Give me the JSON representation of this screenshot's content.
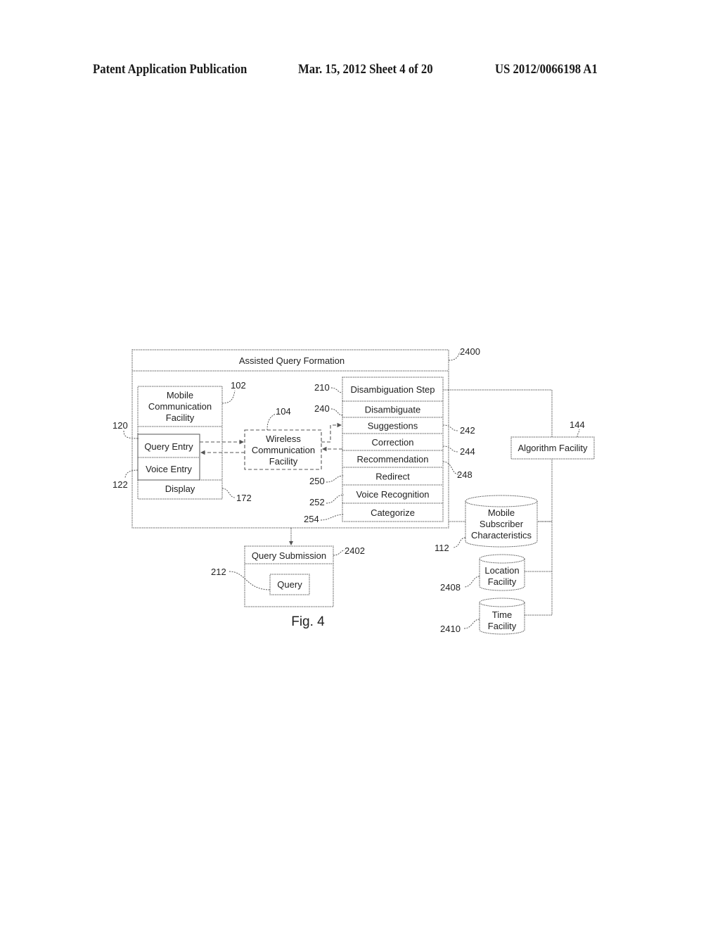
{
  "header": {
    "publication": "Patent Application Publication",
    "date_sheet": "Mar. 15, 2012  Sheet 4 of 20",
    "patent_number": "US 2012/0066198 A1"
  },
  "diagram": {
    "figure_label": "Fig. 4",
    "assisted_query_formation": {
      "title": "Assisted Query Formation",
      "ref": "2400"
    },
    "mobile_communication_facility": {
      "title_lines": [
        "Mobile",
        "Communication",
        "Facility"
      ],
      "ref": "102",
      "query_entry": {
        "label": "Query Entry",
        "ref": "120"
      },
      "voice_entry": {
        "label": "Voice Entry",
        "ref": "122"
      },
      "display": {
        "label": "Display",
        "ref": "172"
      }
    },
    "wireless_communication_facility": {
      "lines": [
        "Wireless",
        "Communication",
        "Facility"
      ],
      "ref": "104"
    },
    "disambiguation_steps": [
      {
        "label": "Disambiguation Step",
        "ref": "210"
      },
      {
        "label": "Disambiguate",
        "ref": "240"
      },
      {
        "label": "Suggestions",
        "ref": "242"
      },
      {
        "label": "Correction",
        "ref": "244"
      },
      {
        "label": "Recommendation",
        "ref": "248"
      },
      {
        "label": "Redirect",
        "ref": "250"
      },
      {
        "label": "Voice Recognition",
        "ref": "252"
      },
      {
        "label": "Categorize",
        "ref": "254"
      }
    ],
    "algorithm_facility": {
      "label": "Algorithm Facility",
      "ref": "144"
    },
    "mobile_subscriber_characteristics": {
      "lines": [
        "Mobile",
        "Subscriber",
        "Characteristics"
      ],
      "ref": "112"
    },
    "location_facility": {
      "lines": [
        "Location",
        "Facility"
      ],
      "ref": "2408"
    },
    "time_facility": {
      "lines": [
        "Time",
        "Facility"
      ],
      "ref": "2410"
    },
    "query_submission": {
      "label": "Query Submission",
      "ref": "2402"
    },
    "query": {
      "label": "Query",
      "ref": "212"
    }
  }
}
